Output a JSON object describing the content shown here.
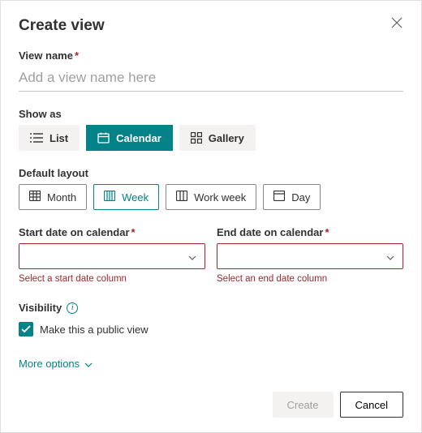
{
  "dialog": {
    "title": "Create view"
  },
  "viewName": {
    "label": "View name",
    "placeholder": "Add a view name here"
  },
  "showAs": {
    "label": "Show as",
    "options": {
      "list": "List",
      "calendar": "Calendar",
      "gallery": "Gallery"
    },
    "selected": "calendar"
  },
  "defaultLayout": {
    "label": "Default layout",
    "options": {
      "month": "Month",
      "week": "Week",
      "workWeek": "Work week",
      "day": "Day"
    },
    "selected": "week"
  },
  "startDate": {
    "label": "Start date on calendar",
    "error": "Select a start date column"
  },
  "endDate": {
    "label": "End date on calendar",
    "error": "Select an end date column"
  },
  "visibility": {
    "label": "Visibility",
    "checkboxLabel": "Make this a public view",
    "checked": true
  },
  "moreOptions": "More options",
  "footer": {
    "create": "Create",
    "cancel": "Cancel"
  }
}
